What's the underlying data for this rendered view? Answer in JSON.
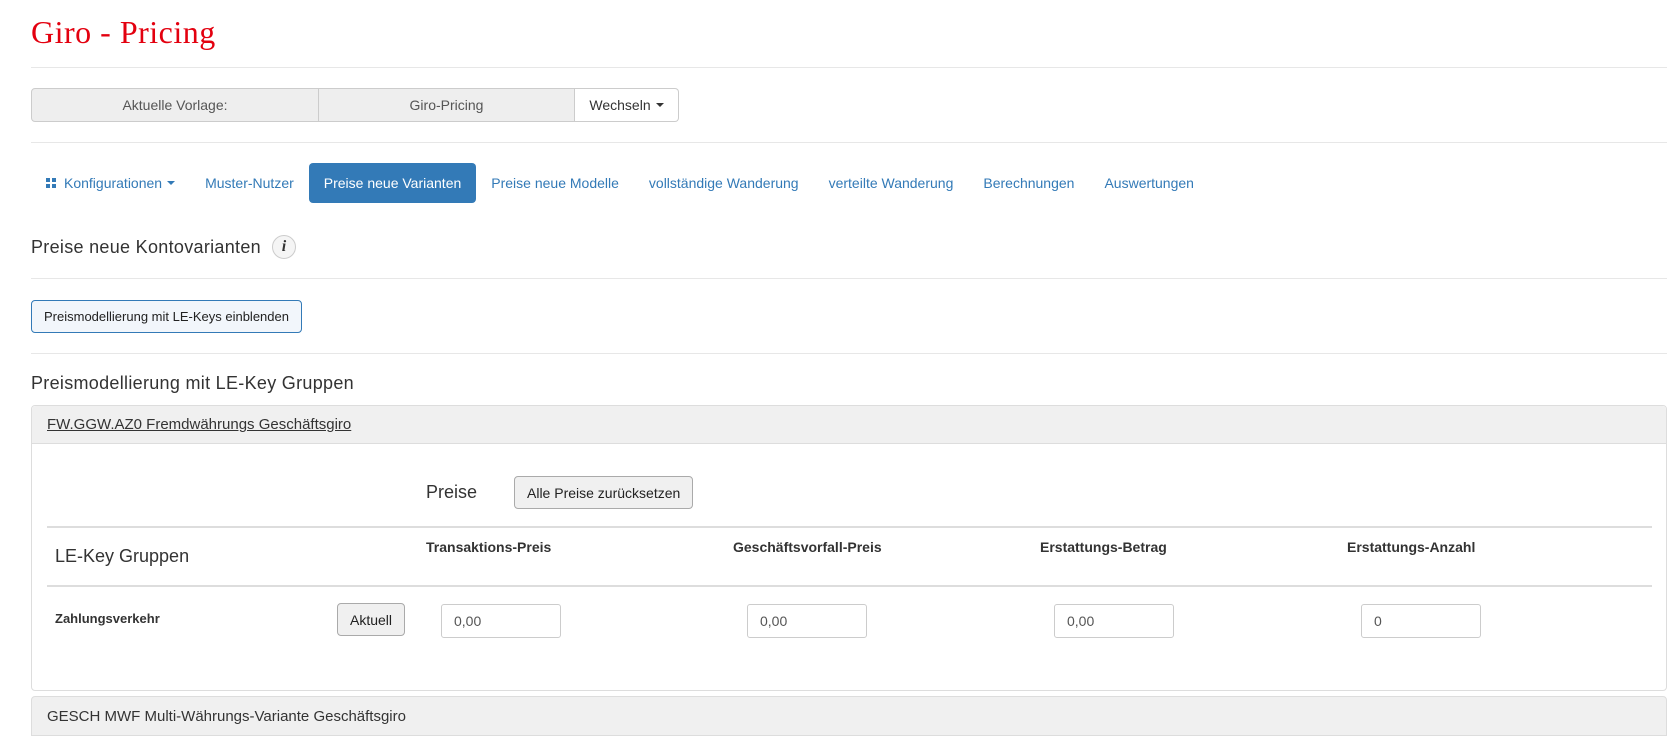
{
  "page": {
    "title": "Giro - Pricing"
  },
  "vorlage": {
    "label": "Aktuelle Vorlage:",
    "value": "Giro-Pricing",
    "switch_label": "Wechseln"
  },
  "nav": {
    "items": [
      {
        "label": "Konfigurationen",
        "icon": "grid-icon",
        "dropdown": true
      },
      {
        "label": "Muster-Nutzer"
      },
      {
        "label": "Preise neue Varianten",
        "active": true
      },
      {
        "label": "Preise neue Modelle"
      },
      {
        "label": "vollständige Wanderung"
      },
      {
        "label": "verteilte Wanderung"
      },
      {
        "label": "Berechnungen"
      },
      {
        "label": "Auswertungen"
      }
    ]
  },
  "section1": {
    "title": "Preise neue Kontovarianten",
    "info_icon": "i"
  },
  "toggle_button": {
    "label": "Preismodellierung mit LE-Keys einblenden"
  },
  "section2": {
    "title": "Preismodellierung mit LE-Key Gruppen"
  },
  "panel1": {
    "title": "FW.GGW.AZ0 Fremdwährungs Geschäftsgiro",
    "preise_label": "Preise",
    "reset_button": "Alle Preise zurücksetzen",
    "group_header": "LE-Key Gruppen",
    "columns": [
      "Transaktions-Preis",
      "Geschäftsvorfall-Preis",
      "Erstattungs-Betrag",
      "Erstattungs-Anzahl"
    ],
    "rows": [
      {
        "label": "Zahlungsverkehr",
        "button": "Aktuell",
        "values": [
          "0,00",
          "0,00",
          "0,00",
          "0"
        ]
      }
    ]
  },
  "panel2": {
    "title": "GESCH MWF Multi-Währungs-Variante Geschäftsgiro"
  },
  "colors": {
    "brand": "#e3000f",
    "link": "#337ab7"
  }
}
